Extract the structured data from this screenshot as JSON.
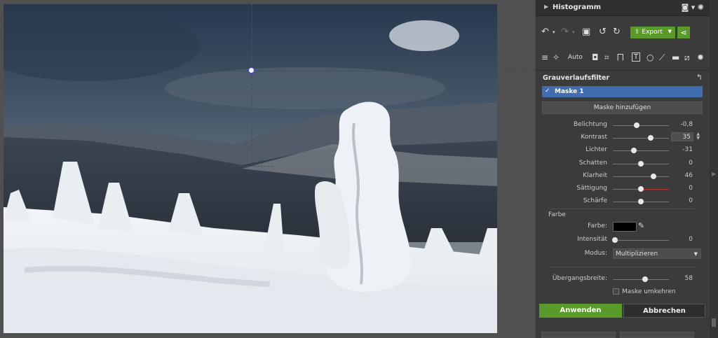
{
  "panel": {
    "histogram_title": "Histogramm",
    "export_label": "Export",
    "auto_label": "Auto",
    "filter_title": "Grauverlaufsfilter",
    "mask_label": "Maske 1",
    "add_mask_label": "Maske hinzufügen",
    "sliders": [
      {
        "label": "Belichtung",
        "value": "-0,8",
        "pos": 0.42
      },
      {
        "label": "Kontrast",
        "value": "35",
        "pos": 0.68
      },
      {
        "label": "Lichter",
        "value": "-31",
        "pos": 0.37
      },
      {
        "label": "Schatten",
        "value": "0",
        "pos": 0.5
      },
      {
        "label": "Klarheit",
        "value": "46",
        "pos": 0.72
      },
      {
        "label": "Sättigung",
        "value": "0",
        "pos": 0.5
      },
      {
        "label": "Schärfe",
        "value": "0",
        "pos": 0.5
      }
    ],
    "color_group": "Farbe",
    "color_label": "Farbe:",
    "intensity_label": "Intensität",
    "intensity_value": "0",
    "mode_label": "Modus:",
    "mode_value": "Multiplizieren",
    "transition_label": "Übergangsbreite:",
    "transition_value": "58",
    "invert_label": "Maske umkehren",
    "apply_label": "Anwenden",
    "cancel_label": "Abbrechen",
    "accent": "#5a9a2a",
    "mask_color": "#3f6db0"
  }
}
